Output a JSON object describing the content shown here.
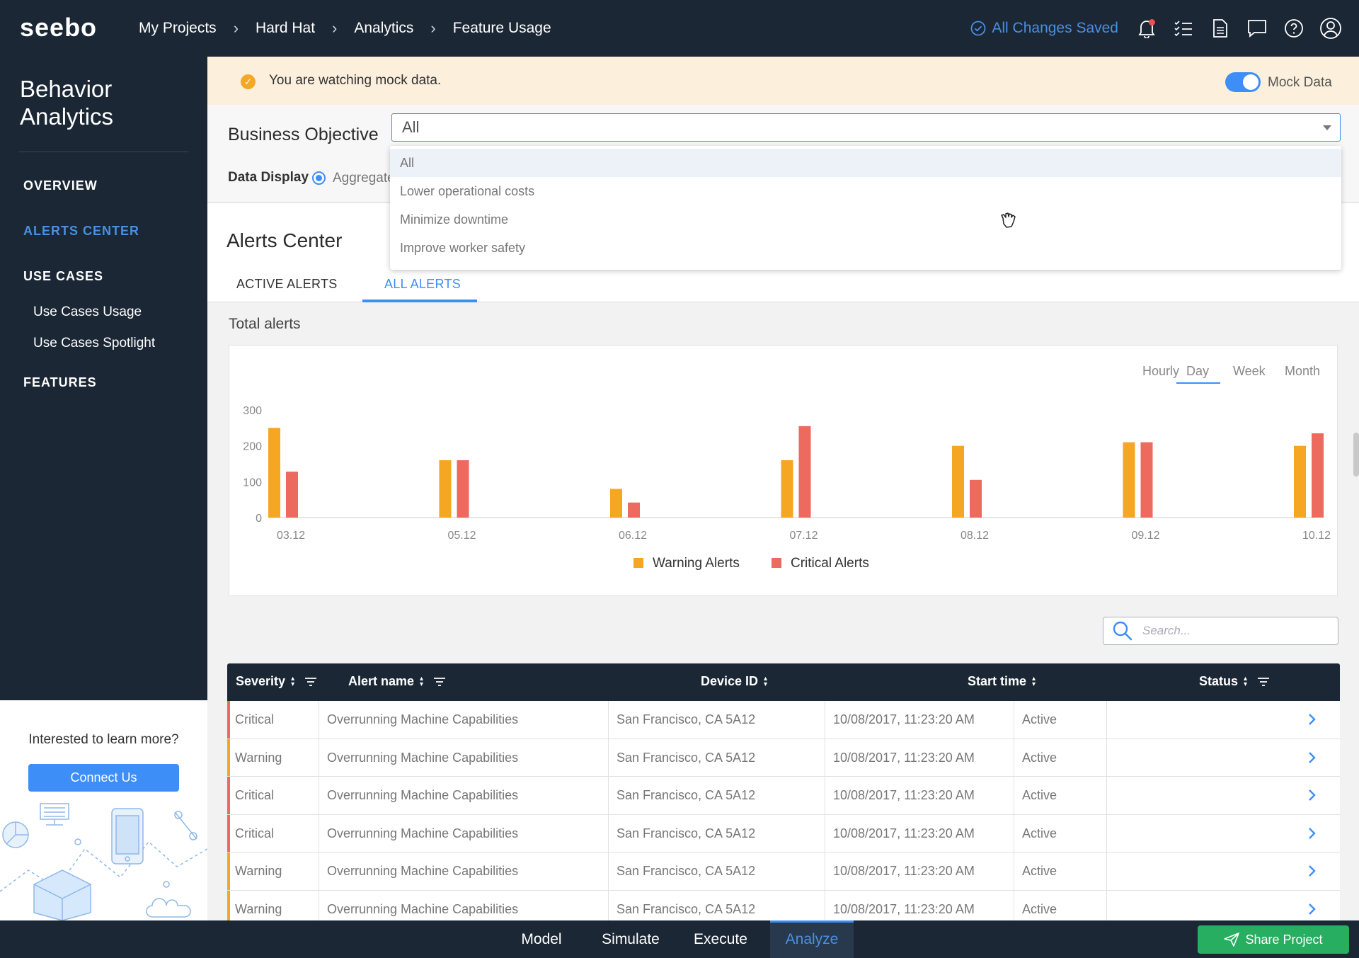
{
  "app": {
    "logo_text": "seebo"
  },
  "breadcrumbs": [
    "My Projects",
    "Hard Hat",
    "Analytics",
    "Feature Usage"
  ],
  "header": {
    "saved_status": "All Changes Saved"
  },
  "sidebar": {
    "title_line1": "Behavior",
    "title_line2": "Analytics",
    "items": [
      {
        "label": "OVERVIEW",
        "active": false
      },
      {
        "label": "ALERTS CENTER",
        "active": true
      },
      {
        "label": "USE CASES",
        "active": false
      },
      {
        "label": "FEATURES",
        "active": false
      }
    ],
    "subitems": [
      "Use Cases Usage",
      "Use Cases Spotlight"
    ],
    "promo": {
      "text": "Interested to learn more?",
      "button": "Connect Us"
    }
  },
  "banner": {
    "text": "You are watching mock data.",
    "toggle_label": "Mock Data",
    "toggle_on": true
  },
  "filters": {
    "objective_label": "Business Objective",
    "objective_value": "All",
    "options": [
      "All",
      "Lower operational costs",
      "Minimize downtime",
      "Improve worker safety"
    ],
    "data_display_label": "Data Display",
    "data_display_value": "Aggregate"
  },
  "alerts": {
    "title": "Alerts Center",
    "tabs": [
      {
        "label": "ACTIVE ALERTS",
        "active": false
      },
      {
        "label": "ALL ALERTS",
        "active": true
      }
    ],
    "total_label": "Total alerts",
    "periods": [
      "Hourly",
      "Day",
      "Week",
      "Month"
    ],
    "active_period": "Day"
  },
  "chart_data": {
    "type": "bar",
    "categories": [
      "03.12",
      "05.12",
      "06.12",
      "07.12",
      "08.12",
      "09.12",
      "10.12"
    ],
    "series": [
      {
        "name": "Warning Alerts",
        "color": "#f5a623",
        "values": [
          250,
          160,
          80,
          160,
          200,
          210,
          200
        ]
      },
      {
        "name": "Critical Alerts",
        "color": "#ec6a5e",
        "values": [
          128,
          160,
          42,
          255,
          105,
          210,
          235
        ]
      }
    ],
    "yticks": [
      0,
      100,
      200,
      300
    ],
    "ylim": [
      0,
      300
    ],
    "legend": "bottom-center"
  },
  "table": {
    "search_placeholder": "Search...",
    "columns": [
      "Severity",
      "Alert name",
      "Device ID",
      "Start time",
      "Status"
    ],
    "rows": [
      {
        "severity": "Critical",
        "name": "Overrunning Machine Capabilities",
        "device": "San Francisco, CA 5A12",
        "start": "10/08/2017, 11:23:20 AM",
        "status": "Active"
      },
      {
        "severity": "Warning",
        "name": "Overrunning Machine Capabilities",
        "device": "San Francisco, CA 5A12",
        "start": "10/08/2017, 11:23:20 AM",
        "status": "Active"
      },
      {
        "severity": "Critical",
        "name": "Overrunning Machine Capabilities",
        "device": "San Francisco, CA 5A12",
        "start": "10/08/2017, 11:23:20 AM",
        "status": "Active"
      },
      {
        "severity": "Critical",
        "name": "Overrunning Machine Capabilities",
        "device": "San Francisco, CA 5A12",
        "start": "10/08/2017, 11:23:20 AM",
        "status": "Active"
      },
      {
        "severity": "Warning",
        "name": "Overrunning Machine Capabilities",
        "device": "San Francisco, CA 5A12",
        "start": "10/08/2017, 11:23:20 AM",
        "status": "Active"
      },
      {
        "severity": "Warning",
        "name": "Overrunning Machine Capabilities",
        "device": "San Francisco, CA 5A12",
        "start": "10/08/2017, 11:23:20 AM",
        "status": "Active"
      }
    ]
  },
  "bottom_nav": {
    "items": [
      "Model",
      "Simulate",
      "Execute",
      "Analyze"
    ],
    "active": "Analyze",
    "share_label": "Share Project"
  },
  "colors": {
    "warning": "#f5a623",
    "critical": "#ec6a5e",
    "accent": "#3e8ef7",
    "navy": "#1b2735",
    "share": "#27ae60"
  }
}
